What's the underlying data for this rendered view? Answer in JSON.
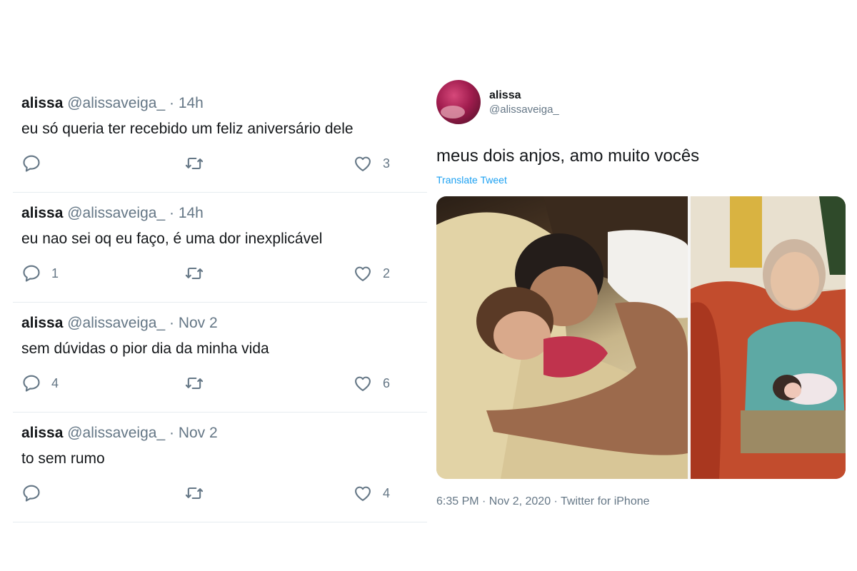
{
  "tweets": [
    {
      "name": "alissa",
      "handle": "@alissaveiga_",
      "separator": "·",
      "time": "14h",
      "text": "eu só queria ter recebido um feliz aniversário dele",
      "replies": "",
      "retweets": "",
      "likes": "3"
    },
    {
      "name": "alissa",
      "handle": "@alissaveiga_",
      "separator": "·",
      "time": "14h",
      "text": "eu nao sei oq eu faço, é uma dor inexplicável",
      "replies": "1",
      "retweets": "",
      "likes": "2"
    },
    {
      "name": "alissa",
      "handle": "@alissaveiga_",
      "separator": "·",
      "time": "Nov 2",
      "text": "sem dúvidas o pior dia da minha vida",
      "replies": "4",
      "retweets": "",
      "likes": "6"
    },
    {
      "name": "alissa",
      "handle": "@alissaveiga_",
      "separator": "·",
      "time": "Nov 2",
      "text": "to sem rumo",
      "replies": "",
      "retweets": "",
      "likes": "4"
    }
  ],
  "detail": {
    "name": "alissa",
    "handle": "@alissaveiga_",
    "text": "meus dois anjos, amo muito vocês",
    "translate_label": "Translate Tweet",
    "meta": "6:35 PM · Nov 2, 2020 · Twitter for iPhone"
  },
  "icons": {
    "reply": "reply-icon",
    "retweet": "retweet-icon",
    "like": "heart-icon"
  },
  "colors": {
    "text_primary": "#14171a",
    "text_secondary": "#657786",
    "link": "#1da1f2",
    "divider": "#e6ecf0"
  }
}
